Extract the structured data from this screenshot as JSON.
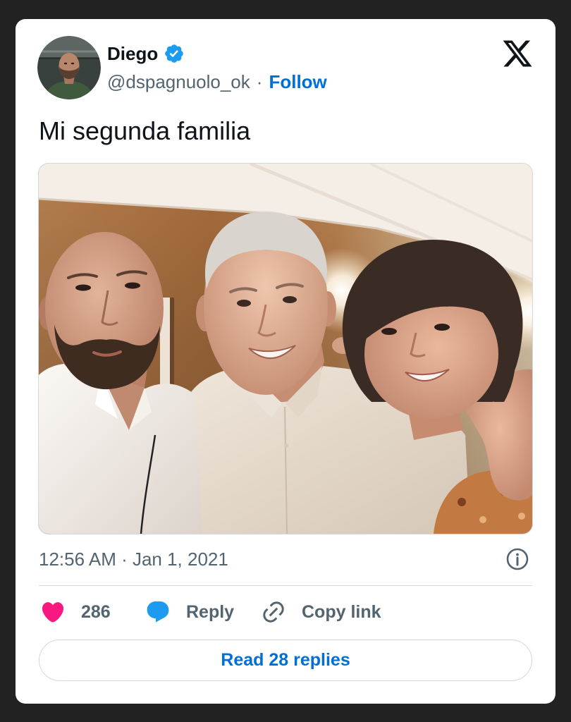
{
  "tweet": {
    "author": {
      "name": "Diego",
      "verified": true,
      "handle": "@dspagnuolo_ok",
      "separator": "·",
      "follow_label": "Follow"
    },
    "text": "Mi segunda familia",
    "media": {
      "type": "photo"
    },
    "timestamp": "12:56 AM · Jan 1, 2021",
    "actions": {
      "likes_count": "286",
      "reply_label": "Reply",
      "copy_link_label": "Copy link"
    },
    "read_replies_label": "Read 28 replies"
  },
  "icons": {
    "avatar": "avatar-photo",
    "verified": "verified-badge-icon",
    "logo": "x-logo-icon",
    "info": "info-icon",
    "like": "heart-icon",
    "reply": "reply-bubble-icon",
    "copy_link": "link-icon"
  },
  "colors": {
    "page_bg": "#222222",
    "card_bg": "#ffffff",
    "text_primary": "#0f1419",
    "text_secondary": "#536471",
    "link_blue": "#006fd6",
    "brand_blue": "#1d9bf0",
    "like_pink": "#f91880",
    "border": "#cfd9de"
  }
}
